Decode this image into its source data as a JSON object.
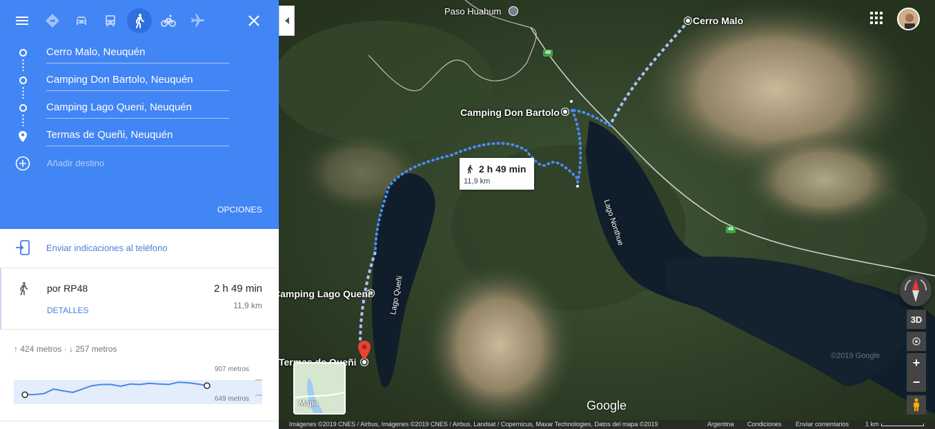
{
  "panel": {
    "stops": [
      {
        "label": "Cerro Malo, Neuquén"
      },
      {
        "label": "Camping Don Bartolo, Neuquén"
      },
      {
        "label": "Camping Lago Queni, Neuquén"
      },
      {
        "label": "Termas de Queñi, Neuquén"
      }
    ],
    "add_destination": "Añadir destino",
    "options": "OPCIONES",
    "send_to_phone": "Enviar indicaciones al teléfono",
    "route": {
      "via": "por RP48",
      "time": "2 h 49 min",
      "distance": "11,9 km",
      "details": "DETALLES"
    },
    "elevation": {
      "up": "424 metros",
      "down": "257 metros",
      "summary": "↑ 424 metros · ↓ 257 metros",
      "max_label": "907 metros",
      "min_label": "649 metros",
      "profile": [
        0.05,
        0.06,
        0.1,
        0.3,
        0.22,
        0.15,
        0.3,
        0.45,
        0.5,
        0.5,
        0.42,
        0.52,
        0.5,
        0.55,
        0.52,
        0.5,
        0.6,
        0.58,
        0.52,
        0.45
      ]
    }
  },
  "map": {
    "labels": {
      "paso": "Paso Huahum",
      "cerro": "Cerro Malo",
      "don_bartolo": "Camping Don Bartolo",
      "lago_queni_camp": "Camping Lago Queni",
      "termas": "Termas de Queñi",
      "lago_nonthue": "Lago Nonthue",
      "lago_queni": "Lago Queñi",
      "copyright_wm": "©2019 Google"
    },
    "road_shields": [
      "48",
      "48"
    ],
    "info": {
      "time": "2 h 49 min",
      "distance": "11,9 km"
    },
    "controls": {
      "three_d": "3D",
      "zoom_in": "+",
      "zoom_out": "−"
    },
    "minimap_label": "Mapa",
    "google": "Google",
    "footer": {
      "imagery": "Imágenes ©2019 CNES / Airbus, Imágenes ©2019 CNES / Airbus, Landsat / Copernicus, Maxar Technologies, Datos del mapa ©2019",
      "country": "Argentina",
      "terms": "Condiciones",
      "feedback": "Enviar comentarios",
      "scale": "1 km"
    }
  },
  "colors": {
    "accent": "#4285f4",
    "route": "#4285f4",
    "pin": "#ea4335"
  }
}
